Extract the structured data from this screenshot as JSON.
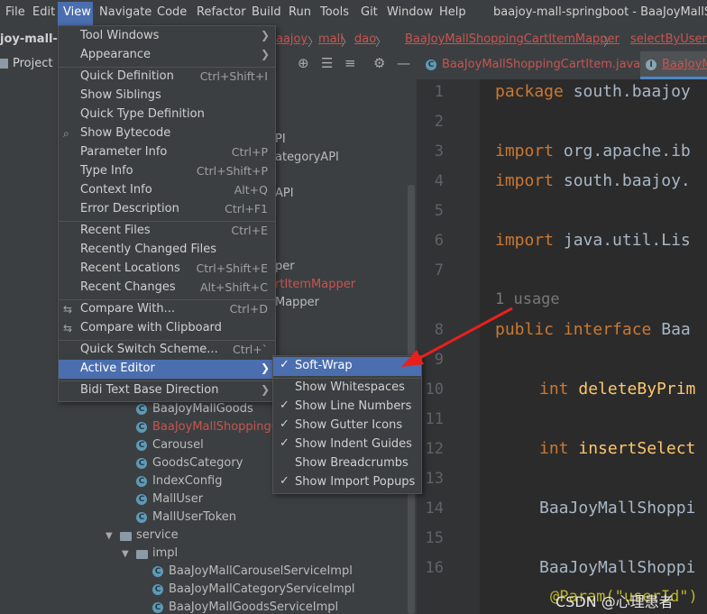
{
  "menubar": {
    "items": [
      "File",
      "Edit",
      "View",
      "Navigate",
      "Code",
      "Refactor",
      "Build",
      "Run",
      "Tools",
      "Git",
      "Window",
      "Help"
    ],
    "window_title": "baajoy-mall-springboot - BaaJoyMallSho"
  },
  "breadcrumbs": {
    "project_name": "joy-mall-sp",
    "parts": [
      "aajoy",
      "mall",
      "dao",
      "BaaJoyMallShoppingCartItemMapper",
      "selectByUserId"
    ]
  },
  "project_panel": {
    "label": "Project"
  },
  "editor_tabs": {
    "tab1": "BaaJoyMallShoppingCartItem.java",
    "tab2": "BaaJoyM"
  },
  "tree": {
    "partial_1": "PI",
    "partial_2": "ategoryAPI",
    "partial_3": "API",
    "partial_4": "per",
    "partial_5": "rtItemMapper",
    "partial_6": "Mapper",
    "rows": [
      "BaaJoyMallGoods",
      "BaaJoyMallShoppingCa",
      "Carousel",
      "GoodsCategory",
      "IndexConfig",
      "MallUser",
      "MallUserToken"
    ],
    "service": "service",
    "impl": "impl",
    "impl_rows": [
      "BaaJoyMallCarouselServiceImpl",
      "BaaJoyMallCategoryServiceImpl",
      "BaaJoyMallGoodsServiceImpl"
    ]
  },
  "editor": {
    "line_numbers": [
      "1",
      "2",
      "3",
      "4",
      "5",
      "6",
      "7",
      "8",
      "9",
      "10",
      "11",
      "12",
      "13",
      "14",
      "15",
      "16"
    ],
    "code": {
      "l1_kw": "package",
      "l1_rest": " south.baajoy",
      "l3_kw": "import",
      "l3_rest": " org.apache.ib",
      "l4_kw": "import",
      "l4_rest": " south.baajoy.",
      "l6_kw": "import",
      "l6_rest": " java.util.Lis",
      "usage": "1 usage",
      "l8_kw": "public interface",
      "l8_rest": " Baa",
      "l10_kw": "int",
      "l10_rest": " deleteByPrim",
      "l12_kw": "int",
      "l12_rest": " insertSelect",
      "l14": "BaaJoyMallShoppi",
      "l16": "BaaJoyMallShoppi",
      "bottom": "@Param(\"userId\") Lo"
    },
    "watermark": "CSDN @心理患者"
  },
  "view_menu": {
    "items": [
      {
        "label": "Tool Windows",
        "shortcut": "",
        "submenu": true
      },
      {
        "label": "Appearance",
        "shortcut": "",
        "submenu": true
      },
      {
        "label": "Quick Definition",
        "shortcut": "Ctrl+Shift+I"
      },
      {
        "label": "Show Siblings",
        "shortcut": ""
      },
      {
        "label": "Quick Type Definition",
        "shortcut": ""
      },
      {
        "label": "Show Bytecode",
        "shortcut": ""
      },
      {
        "label": "Parameter Info",
        "shortcut": "Ctrl+P"
      },
      {
        "label": "Type Info",
        "shortcut": "Ctrl+Shift+P"
      },
      {
        "label": "Context Info",
        "shortcut": "Alt+Q"
      },
      {
        "label": "Error Description",
        "shortcut": "Ctrl+F1"
      },
      {
        "label": "Recent Files",
        "shortcut": "Ctrl+E"
      },
      {
        "label": "Recently Changed Files",
        "shortcut": ""
      },
      {
        "label": "Recent Locations",
        "shortcut": "Ctrl+Shift+E"
      },
      {
        "label": "Recent Changes",
        "shortcut": "Alt+Shift+C"
      },
      {
        "label": "Compare With...",
        "shortcut": "Ctrl+D"
      },
      {
        "label": "Compare with Clipboard",
        "shortcut": ""
      },
      {
        "label": "Quick Switch Scheme...",
        "shortcut": "Ctrl+`"
      },
      {
        "label": "Active Editor",
        "shortcut": "",
        "submenu": true
      },
      {
        "label": "Bidi Text Base Direction",
        "shortcut": "",
        "submenu": true
      }
    ]
  },
  "active_editor_menu": {
    "items": [
      {
        "label": "Soft-Wrap",
        "checked": true
      },
      {
        "label": "Show Whitespaces",
        "checked": false
      },
      {
        "label": "Show Line Numbers",
        "checked": true
      },
      {
        "label": "Show Gutter Icons",
        "checked": true
      },
      {
        "label": "Show Indent Guides",
        "checked": true
      },
      {
        "label": "Show Breadcrumbs",
        "checked": false
      },
      {
        "label": "Show Import Popups",
        "checked": true
      }
    ]
  },
  "colors": {
    "selection": "#4b6eaf",
    "annotation_arrow": "#e8201c"
  }
}
